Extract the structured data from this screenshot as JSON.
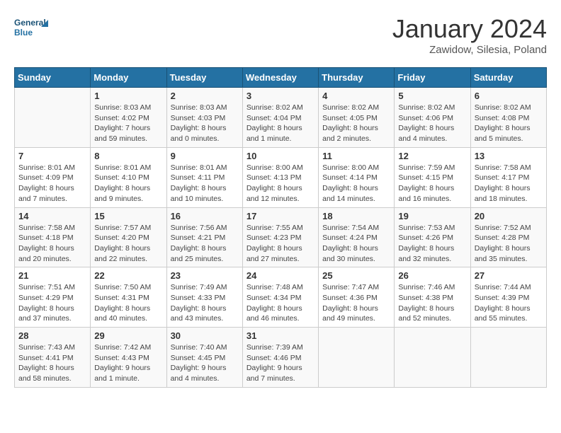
{
  "logo": {
    "line1": "General",
    "line2": "Blue"
  },
  "title": "January 2024",
  "subtitle": "Zawidow, Silesia, Poland",
  "weekdays": [
    "Sunday",
    "Monday",
    "Tuesday",
    "Wednesday",
    "Thursday",
    "Friday",
    "Saturday"
  ],
  "weeks": [
    [
      {
        "day": "",
        "info": ""
      },
      {
        "day": "1",
        "info": "Sunrise: 8:03 AM\nSunset: 4:02 PM\nDaylight: 7 hours\nand 59 minutes."
      },
      {
        "day": "2",
        "info": "Sunrise: 8:03 AM\nSunset: 4:03 PM\nDaylight: 8 hours\nand 0 minutes."
      },
      {
        "day": "3",
        "info": "Sunrise: 8:02 AM\nSunset: 4:04 PM\nDaylight: 8 hours\nand 1 minute."
      },
      {
        "day": "4",
        "info": "Sunrise: 8:02 AM\nSunset: 4:05 PM\nDaylight: 8 hours\nand 2 minutes."
      },
      {
        "day": "5",
        "info": "Sunrise: 8:02 AM\nSunset: 4:06 PM\nDaylight: 8 hours\nand 4 minutes."
      },
      {
        "day": "6",
        "info": "Sunrise: 8:02 AM\nSunset: 4:08 PM\nDaylight: 8 hours\nand 5 minutes."
      }
    ],
    [
      {
        "day": "7",
        "info": "Sunrise: 8:01 AM\nSunset: 4:09 PM\nDaylight: 8 hours\nand 7 minutes."
      },
      {
        "day": "8",
        "info": "Sunrise: 8:01 AM\nSunset: 4:10 PM\nDaylight: 8 hours\nand 9 minutes."
      },
      {
        "day": "9",
        "info": "Sunrise: 8:01 AM\nSunset: 4:11 PM\nDaylight: 8 hours\nand 10 minutes."
      },
      {
        "day": "10",
        "info": "Sunrise: 8:00 AM\nSunset: 4:13 PM\nDaylight: 8 hours\nand 12 minutes."
      },
      {
        "day": "11",
        "info": "Sunrise: 8:00 AM\nSunset: 4:14 PM\nDaylight: 8 hours\nand 14 minutes."
      },
      {
        "day": "12",
        "info": "Sunrise: 7:59 AM\nSunset: 4:15 PM\nDaylight: 8 hours\nand 16 minutes."
      },
      {
        "day": "13",
        "info": "Sunrise: 7:58 AM\nSunset: 4:17 PM\nDaylight: 8 hours\nand 18 minutes."
      }
    ],
    [
      {
        "day": "14",
        "info": "Sunrise: 7:58 AM\nSunset: 4:18 PM\nDaylight: 8 hours\nand 20 minutes."
      },
      {
        "day": "15",
        "info": "Sunrise: 7:57 AM\nSunset: 4:20 PM\nDaylight: 8 hours\nand 22 minutes."
      },
      {
        "day": "16",
        "info": "Sunrise: 7:56 AM\nSunset: 4:21 PM\nDaylight: 8 hours\nand 25 minutes."
      },
      {
        "day": "17",
        "info": "Sunrise: 7:55 AM\nSunset: 4:23 PM\nDaylight: 8 hours\nand 27 minutes."
      },
      {
        "day": "18",
        "info": "Sunrise: 7:54 AM\nSunset: 4:24 PM\nDaylight: 8 hours\nand 30 minutes."
      },
      {
        "day": "19",
        "info": "Sunrise: 7:53 AM\nSunset: 4:26 PM\nDaylight: 8 hours\nand 32 minutes."
      },
      {
        "day": "20",
        "info": "Sunrise: 7:52 AM\nSunset: 4:28 PM\nDaylight: 8 hours\nand 35 minutes."
      }
    ],
    [
      {
        "day": "21",
        "info": "Sunrise: 7:51 AM\nSunset: 4:29 PM\nDaylight: 8 hours\nand 37 minutes."
      },
      {
        "day": "22",
        "info": "Sunrise: 7:50 AM\nSunset: 4:31 PM\nDaylight: 8 hours\nand 40 minutes."
      },
      {
        "day": "23",
        "info": "Sunrise: 7:49 AM\nSunset: 4:33 PM\nDaylight: 8 hours\nand 43 minutes."
      },
      {
        "day": "24",
        "info": "Sunrise: 7:48 AM\nSunset: 4:34 PM\nDaylight: 8 hours\nand 46 minutes."
      },
      {
        "day": "25",
        "info": "Sunrise: 7:47 AM\nSunset: 4:36 PM\nDaylight: 8 hours\nand 49 minutes."
      },
      {
        "day": "26",
        "info": "Sunrise: 7:46 AM\nSunset: 4:38 PM\nDaylight: 8 hours\nand 52 minutes."
      },
      {
        "day": "27",
        "info": "Sunrise: 7:44 AM\nSunset: 4:39 PM\nDaylight: 8 hours\nand 55 minutes."
      }
    ],
    [
      {
        "day": "28",
        "info": "Sunrise: 7:43 AM\nSunset: 4:41 PM\nDaylight: 8 hours\nand 58 minutes."
      },
      {
        "day": "29",
        "info": "Sunrise: 7:42 AM\nSunset: 4:43 PM\nDaylight: 9 hours\nand 1 minute."
      },
      {
        "day": "30",
        "info": "Sunrise: 7:40 AM\nSunset: 4:45 PM\nDaylight: 9 hours\nand 4 minutes."
      },
      {
        "day": "31",
        "info": "Sunrise: 7:39 AM\nSunset: 4:46 PM\nDaylight: 9 hours\nand 7 minutes."
      },
      {
        "day": "",
        "info": ""
      },
      {
        "day": "",
        "info": ""
      },
      {
        "day": "",
        "info": ""
      }
    ]
  ]
}
